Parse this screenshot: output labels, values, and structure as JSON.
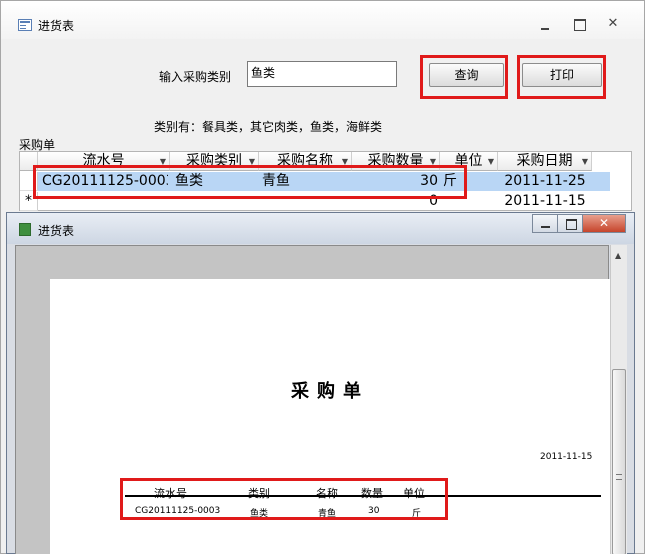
{
  "main_window": {
    "title": "进货表",
    "input_label": "输入采购类别",
    "input_value": "鱼类",
    "query_button": "查询",
    "print_button": "打印",
    "category_hint": "类别有：餐具类，其它肉类，鱼类，海鲜类",
    "subform_label": "采购单"
  },
  "datasheet": {
    "columns": [
      "流水号",
      "采购类别",
      "采购名称",
      "采购数量",
      "单位",
      "采购日期"
    ],
    "rows": [
      {
        "id": "CG20111125-0003",
        "category": "鱼类",
        "name": "青鱼",
        "qty": "30",
        "unit": "斤",
        "date": "2011-11-25"
      }
    ],
    "new_row": {
      "marker": "*",
      "qty": "0",
      "date": "2011-11-15"
    }
  },
  "report_window": {
    "title": "进货表",
    "report_title": "采购单",
    "date": "2011-11-15",
    "headers": [
      "流水号",
      "类别",
      "名称",
      "数量",
      "单位"
    ],
    "row": {
      "id": "CG20111125-0003",
      "category": "鱼类",
      "name": "青鱼",
      "qty": "30",
      "unit": "斤"
    }
  },
  "colors": {
    "highlight": "#e01a1a",
    "selected_row": "#b9d6f5"
  },
  "icons": [
    "form-icon",
    "report-icon",
    "minimize-icon",
    "maximize-icon",
    "close-icon",
    "scroll-up-icon",
    "column-sort-icon",
    "new-record-icon"
  ]
}
